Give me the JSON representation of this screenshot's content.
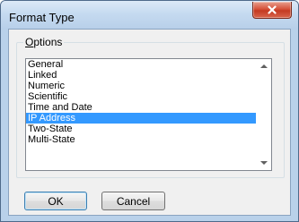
{
  "window": {
    "title": "Format Type"
  },
  "options_group": {
    "label_accel": "O",
    "label_rest": "ptions"
  },
  "list": {
    "items": [
      "General",
      "Linked",
      "Numeric",
      "Scientific",
      "Time and Date",
      "IP Address",
      "Two-State",
      "Multi-State"
    ],
    "selected_index": 5
  },
  "buttons": {
    "ok": "OK",
    "cancel": "Cancel"
  },
  "colors": {
    "selection": "#3399ff",
    "close_button": "#c43a22"
  }
}
